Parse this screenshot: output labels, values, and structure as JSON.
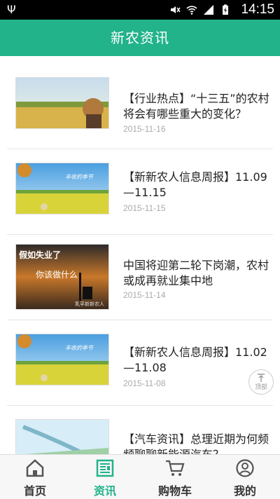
{
  "statusbar": {
    "time": "14:15",
    "usb_icon": "usb-icon"
  },
  "header": {
    "title": "新农资讯"
  },
  "news": [
    {
      "title": "【行业热点】“十三五”的农村将会有哪些重大的变化？",
      "date": "2015-11-16"
    },
    {
      "title": "【新新农人信息周报】11.09—11.15",
      "date": "2015-11-15",
      "thumb_caption": "丰收的季节"
    },
    {
      "title": "中国将迎第二轮下岗潮，农村或成再就业集中地",
      "date": "2015-11-14",
      "thumb_line1": "假如失业了",
      "thumb_line2": "你该做什么",
      "thumb_mark": "乳孚新新农人"
    },
    {
      "title": "【新新农人信息周报】11.02—11.08",
      "date": "2015-11-08",
      "thumb_caption": "丰收的季节"
    },
    {
      "title": "【汽车资讯】总理近期为何频频聊聊新能源汽车？",
      "date": ""
    }
  ],
  "top_button": {
    "label": "顶部"
  },
  "tabs": [
    {
      "label": "首页",
      "icon": "home-icon"
    },
    {
      "label": "资讯",
      "icon": "news-icon"
    },
    {
      "label": "购物车",
      "icon": "cart-icon"
    },
    {
      "label": "我的",
      "icon": "user-icon"
    }
  ]
}
